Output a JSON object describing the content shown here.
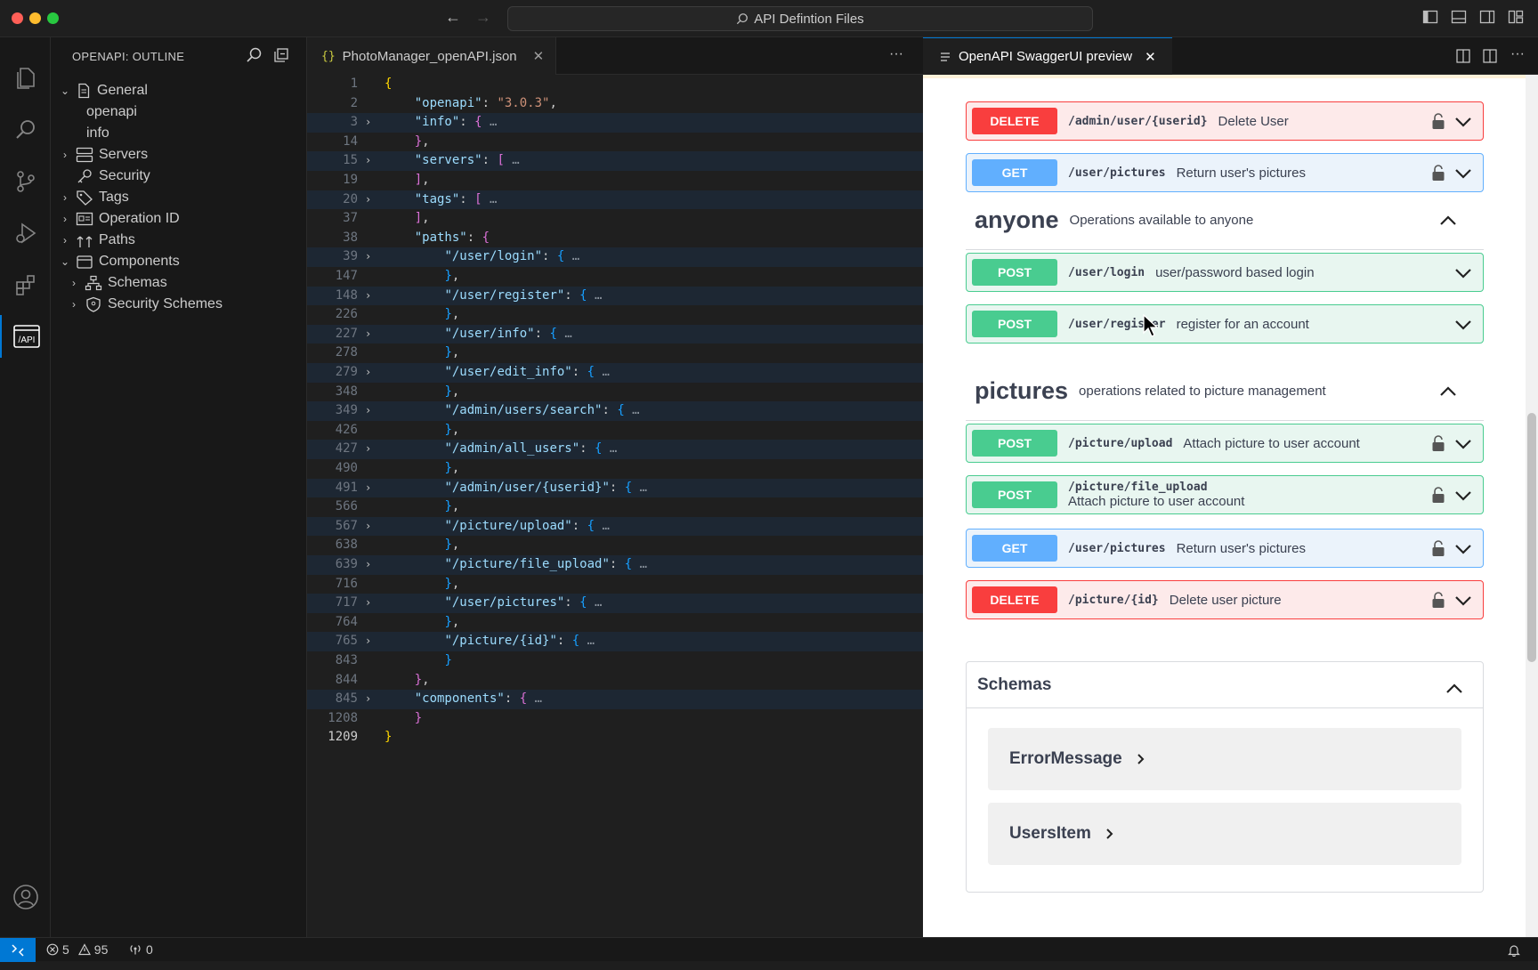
{
  "window": {
    "title": "API Defintion Files"
  },
  "sidebar": {
    "title": "OPENAPI: OUTLINE",
    "items": [
      {
        "label": "General",
        "expanded": true,
        "icon": "document-icon"
      },
      {
        "label": "openapi"
      },
      {
        "label": "info"
      },
      {
        "label": "Servers",
        "icon": "server-icon"
      },
      {
        "label": "Security",
        "icon": "key-icon"
      },
      {
        "label": "Tags",
        "icon": "tag-icon"
      },
      {
        "label": "Operation ID",
        "icon": "id-card-icon"
      },
      {
        "label": "Paths",
        "icon": "paths-icon"
      },
      {
        "label": "Components",
        "expanded": true,
        "icon": "box-icon"
      },
      {
        "label": "Schemas",
        "icon": "hierarchy-icon"
      },
      {
        "label": "Security Schemes",
        "icon": "shield-icon"
      }
    ]
  },
  "editor": {
    "tab": {
      "label": "PhotoManager_openAPI.json",
      "icon_text": "{}"
    },
    "lines": [
      {
        "n": "1",
        "indent": "",
        "text": "{"
      },
      {
        "n": "2",
        "indent": "    ",
        "key": "\"openapi\"",
        "value": "\"3.0.3\"",
        "tail": ","
      },
      {
        "n": "3",
        "indent": "    ",
        "key": "\"info\"",
        "open": "{",
        "folded": true
      },
      {
        "n": "14",
        "indent": "    ",
        "close": "}",
        "tail": ","
      },
      {
        "n": "15",
        "indent": "    ",
        "key": "\"servers\"",
        "open": "[",
        "folded": true
      },
      {
        "n": "19",
        "indent": "    ",
        "close": "]",
        "tail": ","
      },
      {
        "n": "20",
        "indent": "    ",
        "key": "\"tags\"",
        "open": "[",
        "folded": true
      },
      {
        "n": "37",
        "indent": "    ",
        "close": "]",
        "tail": ","
      },
      {
        "n": "38",
        "indent": "    ",
        "key": "\"paths\"",
        "open": "{"
      },
      {
        "n": "39",
        "indent": "        ",
        "key": "\"/user/login\"",
        "open": "{",
        "folded": true
      },
      {
        "n": "147",
        "indent": "        ",
        "close": "}",
        "tail": ","
      },
      {
        "n": "148",
        "indent": "        ",
        "key": "\"/user/register\"",
        "open": "{",
        "folded": true
      },
      {
        "n": "226",
        "indent": "        ",
        "close": "}",
        "tail": ","
      },
      {
        "n": "227",
        "indent": "        ",
        "key": "\"/user/info\"",
        "open": "{",
        "folded": true
      },
      {
        "n": "278",
        "indent": "        ",
        "close": "}",
        "tail": ","
      },
      {
        "n": "279",
        "indent": "        ",
        "key": "\"/user/edit_info\"",
        "open": "{",
        "folded": true
      },
      {
        "n": "348",
        "indent": "        ",
        "close": "}",
        "tail": ","
      },
      {
        "n": "349",
        "indent": "        ",
        "key": "\"/admin/users/search\"",
        "open": "{",
        "folded": true
      },
      {
        "n": "426",
        "indent": "        ",
        "close": "}",
        "tail": ","
      },
      {
        "n": "427",
        "indent": "        ",
        "key": "\"/admin/all_users\"",
        "open": "{",
        "folded": true
      },
      {
        "n": "490",
        "indent": "        ",
        "close": "}",
        "tail": ","
      },
      {
        "n": "491",
        "indent": "        ",
        "key": "\"/admin/user/{userid}\"",
        "open": "{",
        "folded": true
      },
      {
        "n": "566",
        "indent": "        ",
        "close": "}",
        "tail": ","
      },
      {
        "n": "567",
        "indent": "        ",
        "key": "\"/picture/upload\"",
        "open": "{",
        "folded": true
      },
      {
        "n": "638",
        "indent": "        ",
        "close": "}",
        "tail": ","
      },
      {
        "n": "639",
        "indent": "        ",
        "key": "\"/picture/file_upload\"",
        "open": "{",
        "folded": true
      },
      {
        "n": "716",
        "indent": "        ",
        "close": "}",
        "tail": ","
      },
      {
        "n": "717",
        "indent": "        ",
        "key": "\"/user/pictures\"",
        "open": "{",
        "folded": true
      },
      {
        "n": "764",
        "indent": "        ",
        "close": "}",
        "tail": ","
      },
      {
        "n": "765",
        "indent": "        ",
        "key": "\"/picture/{id}\"",
        "open": "{",
        "folded": true
      },
      {
        "n": "843",
        "indent": "        ",
        "close": "}"
      },
      {
        "n": "844",
        "indent": "    ",
        "close": "}",
        "tail": ","
      },
      {
        "n": "845",
        "indent": "    ",
        "key": "\"components\"",
        "open": "{",
        "folded": true
      },
      {
        "n": "1208",
        "indent": "    ",
        "close": "}"
      },
      {
        "n": "1209",
        "indent": "",
        "text": "}",
        "current": true
      }
    ]
  },
  "preview": {
    "tab": {
      "label": "OpenAPI SwaggerUI preview"
    },
    "ops_top": [
      {
        "method": "DELETE",
        "path": "/admin/user/{userid}",
        "desc": "Delete User",
        "locked": true
      },
      {
        "method": "GET",
        "path": "/user/pictures",
        "desc": "Return user's pictures",
        "locked": true
      }
    ],
    "tags": [
      {
        "name": "anyone",
        "desc": "Operations available to anyone",
        "ops": [
          {
            "method": "POST",
            "path": "/user/login",
            "desc": "user/password based login",
            "locked": false
          },
          {
            "method": "POST",
            "path": "/user/register",
            "desc": "register for an account",
            "locked": false
          }
        ]
      },
      {
        "name": "pictures",
        "desc": "operations related to picture management",
        "ops": [
          {
            "method": "POST",
            "path": "/picture/upload",
            "desc": "Attach picture to user account",
            "locked": true
          },
          {
            "method": "POST",
            "path": "/picture/file_upload",
            "desc": "Attach picture to user account",
            "locked": true,
            "stacked": true
          },
          {
            "method": "GET",
            "path": "/user/pictures",
            "desc": "Return user's pictures",
            "locked": true
          },
          {
            "method": "DELETE",
            "path": "/picture/{id}",
            "desc": "Delete user picture",
            "locked": true
          }
        ]
      }
    ],
    "schemas": {
      "title": "Schemas",
      "models": [
        "ErrorMessage",
        "UsersItem"
      ]
    }
  },
  "status": {
    "errors": "5",
    "warnings": "95",
    "ports": "0"
  },
  "colors": {
    "delete": "#f93e3e",
    "get": "#61affe",
    "post": "#49cc90",
    "accent": "#0078d4"
  }
}
